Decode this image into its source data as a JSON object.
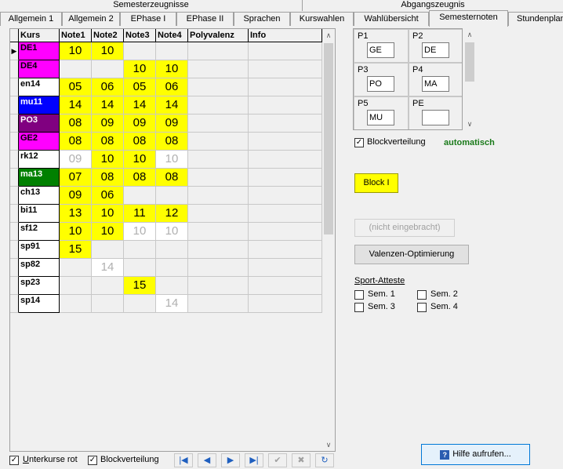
{
  "tab_groups": {
    "left": "Semesterzeugnisse",
    "right": "Abgangszeugnis"
  },
  "tabs": [
    {
      "label": "Allgemein 1"
    },
    {
      "label": "Allgemein 2"
    },
    {
      "label": "EPhase I"
    },
    {
      "label": "EPhase II"
    },
    {
      "label": "Sprachen"
    },
    {
      "label": "Kurswahlen"
    },
    {
      "label": "Wahlübersicht"
    },
    {
      "label": "Semesternoten",
      "active": true
    },
    {
      "label": "Stundenplan"
    }
  ],
  "grid": {
    "headers": [
      "Kurs",
      "Note1",
      "Note2",
      "Note3",
      "Note4",
      "Polyvalenz",
      "Info"
    ],
    "rows": [
      {
        "kurs": "DE1",
        "kurs_bg": "#ff00ff",
        "notes": [
          "10",
          "10",
          "",
          ""
        ],
        "yellow": [
          true,
          true,
          false,
          false
        ],
        "dim": [
          false,
          false,
          false,
          false
        ],
        "current": true
      },
      {
        "kurs": "DE4",
        "kurs_bg": "#ff00ff",
        "notes": [
          "",
          "",
          "10",
          "10"
        ],
        "yellow": [
          false,
          false,
          true,
          true
        ],
        "dim": [
          false,
          false,
          false,
          false
        ]
      },
      {
        "kurs": "en14",
        "kurs_bg": "#ffffff",
        "notes": [
          "05",
          "06",
          "05",
          "06"
        ],
        "yellow": [
          true,
          true,
          true,
          true
        ],
        "dim": [
          false,
          false,
          false,
          false
        ]
      },
      {
        "kurs": "mu11",
        "kurs_bg": "#0000ff",
        "kurs_fg": "#ffffff",
        "notes": [
          "14",
          "14",
          "14",
          "14"
        ],
        "yellow": [
          true,
          true,
          true,
          true
        ],
        "dim": [
          false,
          false,
          false,
          false
        ]
      },
      {
        "kurs": "PO3",
        "kurs_bg": "#800080",
        "kurs_fg": "#ffffff",
        "notes": [
          "08",
          "09",
          "09",
          "09"
        ],
        "yellow": [
          true,
          true,
          true,
          true
        ],
        "dim": [
          false,
          false,
          false,
          false
        ]
      },
      {
        "kurs": "GE2",
        "kurs_bg": "#ff00ff",
        "notes": [
          "08",
          "08",
          "08",
          "08"
        ],
        "yellow": [
          true,
          true,
          true,
          true
        ],
        "dim": [
          false,
          false,
          false,
          false
        ]
      },
      {
        "kurs": "rk12",
        "kurs_bg": "#ffffff",
        "notes": [
          "09",
          "10",
          "10",
          "10"
        ],
        "yellow": [
          false,
          true,
          true,
          false
        ],
        "dim": [
          true,
          false,
          false,
          true
        ],
        "white": [
          true,
          false,
          false,
          true
        ]
      },
      {
        "kurs": "ma13",
        "kurs_bg": "#008000",
        "kurs_fg": "#ffffff",
        "notes": [
          "07",
          "08",
          "08",
          "08"
        ],
        "yellow": [
          true,
          true,
          true,
          true
        ],
        "dim": [
          false,
          false,
          false,
          false
        ]
      },
      {
        "kurs": "ch13",
        "kurs_bg": "#ffffff",
        "notes": [
          "09",
          "06",
          "",
          ""
        ],
        "yellow": [
          true,
          true,
          false,
          false
        ],
        "dim": [
          false,
          false,
          false,
          false
        ]
      },
      {
        "kurs": "bi11",
        "kurs_bg": "#ffffff",
        "notes": [
          "13",
          "10",
          "11",
          "12"
        ],
        "yellow": [
          true,
          true,
          true,
          true
        ],
        "dim": [
          false,
          false,
          false,
          false
        ]
      },
      {
        "kurs": "sf12",
        "kurs_bg": "#ffffff",
        "notes": [
          "10",
          "10",
          "10",
          "10"
        ],
        "yellow": [
          true,
          true,
          false,
          false
        ],
        "dim": [
          false,
          false,
          true,
          true
        ],
        "white": [
          false,
          false,
          true,
          true
        ]
      },
      {
        "kurs": "sp91",
        "kurs_bg": "#ffffff",
        "notes": [
          "15",
          "",
          "",
          ""
        ],
        "yellow": [
          true,
          false,
          false,
          false
        ],
        "dim": [
          false,
          false,
          false,
          false
        ]
      },
      {
        "kurs": "sp82",
        "kurs_bg": "#ffffff",
        "notes": [
          "",
          "14",
          "",
          ""
        ],
        "yellow": [
          false,
          false,
          false,
          false
        ],
        "dim": [
          false,
          true,
          false,
          false
        ],
        "white": [
          false,
          true,
          false,
          false
        ]
      },
      {
        "kurs": "sp23",
        "kurs_bg": "#ffffff",
        "notes": [
          "",
          "",
          "15",
          ""
        ],
        "yellow": [
          false,
          false,
          true,
          false
        ],
        "dim": [
          false,
          false,
          false,
          false
        ]
      },
      {
        "kurs": "sp14",
        "kurs_bg": "#ffffff",
        "notes": [
          "",
          "",
          "",
          "14"
        ],
        "yellow": [
          false,
          false,
          false,
          false
        ],
        "dim": [
          false,
          false,
          false,
          true
        ],
        "white": [
          false,
          false,
          false,
          true
        ]
      }
    ]
  },
  "pfach": [
    {
      "label": "P1",
      "value": "GE"
    },
    {
      "label": "P2",
      "value": "DE"
    },
    {
      "label": "P3",
      "value": "PO"
    },
    {
      "label": "P4",
      "value": "MA"
    },
    {
      "label": "P5",
      "value": "MU"
    },
    {
      "label": "PE",
      "value": ""
    }
  ],
  "blockverteilung": {
    "label": "Blockverteilung",
    "checked": true,
    "status": "automatisch"
  },
  "buttons": {
    "block": "Block I",
    "nicht_eingebracht": "(nicht eingebracht)",
    "valenzen": "Valenzen-Optimierung",
    "hilfe": "Hilfe aufrufen..."
  },
  "sport_atteste": {
    "title": "Sport-Atteste",
    "items": [
      "Sem. 1",
      "Sem. 2",
      "Sem. 3",
      "Sem. 4"
    ]
  },
  "bottom": {
    "unterkurse_label": "Unterkurse rot",
    "blockverteilung_label": "Blockverteilung"
  },
  "nav_icons": [
    "first-icon",
    "prev-icon",
    "next-icon",
    "last-icon",
    "confirm-icon",
    "cancel-icon",
    "refresh-icon"
  ]
}
